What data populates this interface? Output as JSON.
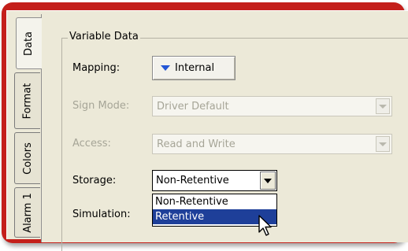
{
  "tabs": [
    {
      "label": "Data",
      "selected": true
    },
    {
      "label": "Format",
      "selected": false
    },
    {
      "label": "Colors",
      "selected": false
    },
    {
      "label": "Alarm 1",
      "selected": false
    }
  ],
  "group": {
    "title": "Variable Data"
  },
  "mapping": {
    "label": "Mapping:",
    "value": "Internal"
  },
  "sign_mode": {
    "label": "Sign Mode:",
    "value": "Driver Default",
    "enabled": false
  },
  "access": {
    "label": "Access:",
    "value": "Read and Write",
    "enabled": false
  },
  "storage": {
    "label": "Storage:",
    "value": "Non-Retentive",
    "options": [
      "Non-Retentive",
      "Retentive"
    ],
    "highlighted": "Retentive"
  },
  "simulation": {
    "label": "Simulation:"
  },
  "colors": {
    "frame": "#c41f1b",
    "panel": "#ece9d8",
    "highlight": "#1e3f99",
    "mapping_arrow": "#2356d6"
  }
}
